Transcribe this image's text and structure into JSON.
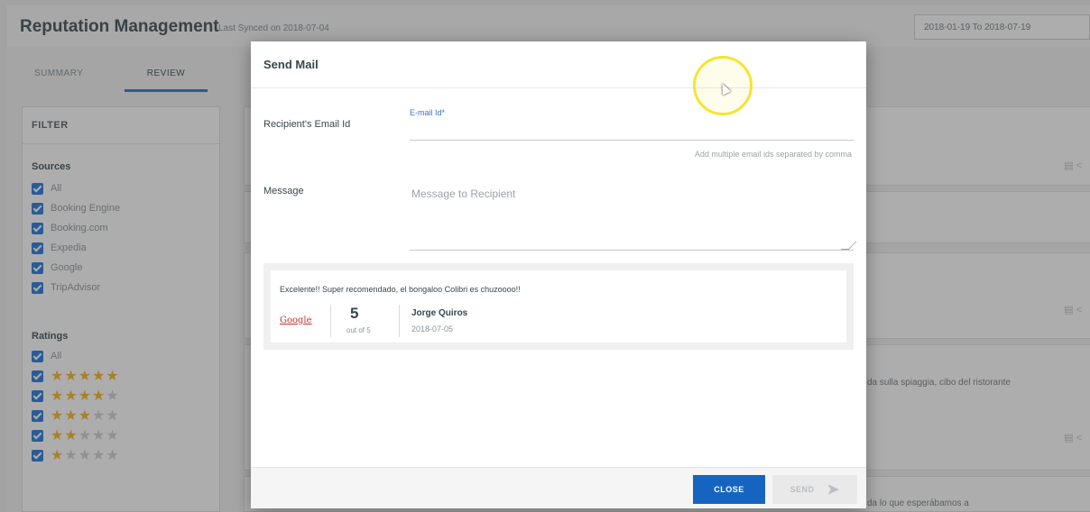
{
  "app": {
    "title": "Reputation Management",
    "subtitle": "Last Synced on 2018-07-04",
    "date_range": "2018-01-19 To 2018-07-19"
  },
  "tabs": [
    {
      "label": "SUMMARY",
      "active": false
    },
    {
      "label": "REVIEW",
      "active": true
    }
  ],
  "filter": {
    "title": "FILTER",
    "sources_label": "Sources",
    "sources": [
      "All",
      "Booking Engine",
      "Booking.com",
      "Expedia",
      "Google",
      "TripAdvisor"
    ],
    "ratings_label": "Ratings",
    "ratings": [
      {
        "label": "All"
      },
      {
        "stars": 5
      },
      {
        "stars": 4
      },
      {
        "stars": 3
      },
      {
        "stars": 2
      },
      {
        "stars": 1
      }
    ]
  },
  "background": {
    "review_snippet": "da sulla spiaggia, cibo del ristorante",
    "review_snippet_2": "da lo que esperábamos a"
  },
  "modal": {
    "title": "Send Mail",
    "recipient_label": "Recipient's Email Id",
    "email_placeholder": "E-mail Id*",
    "email_value": "",
    "email_hint": "Add multiple email ids separated by comma",
    "message_label": "Message",
    "message_placeholder": "Message to Recipient",
    "review": {
      "text": "Excelente!! Super recomendado, el bongaloo Colibri es chuzoooo!!",
      "source": "Google",
      "rating": "5",
      "rating_of": "out of 5",
      "reviewer": "Jorge Quiros",
      "date": "2018-07-05"
    },
    "close_label": "CLOSE",
    "send_label": "SEND"
  },
  "colors": {
    "accent": "#1565c0",
    "checkbox": "#1e73d8",
    "star": "#f3b51b",
    "cursor_ring": "#f3e533"
  }
}
